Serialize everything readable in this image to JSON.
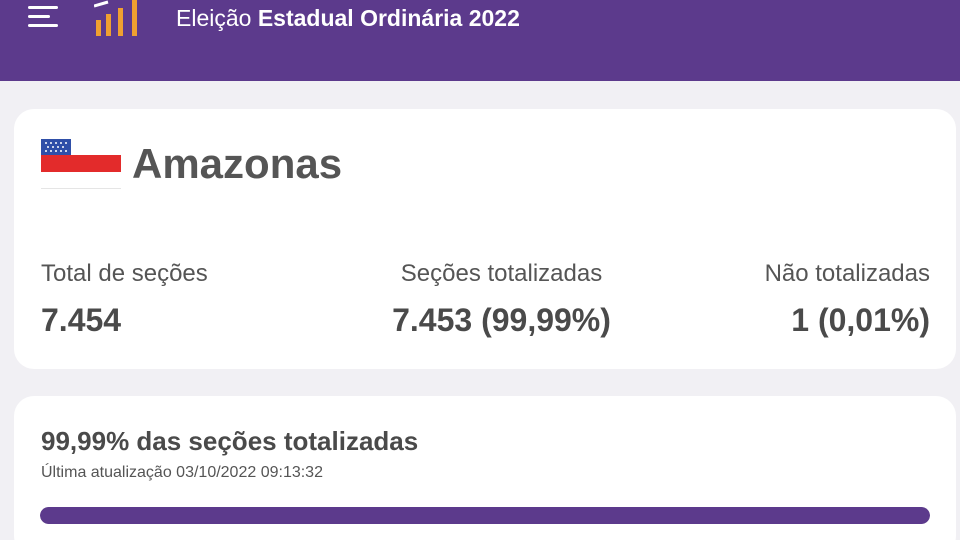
{
  "header": {
    "title_prefix": "Eleição",
    "title_main": "Estadual Ordinária 2022",
    "bar_color": "#5c3a8c",
    "menu_icon": "hamburger-menu-icon",
    "logo_icon": "bar-chart-logo-icon"
  },
  "state": {
    "name": "Amazonas",
    "flag_icon": "amazonas-flag-icon",
    "stats": [
      {
        "label": "Total de seções",
        "value": "7.454"
      },
      {
        "label": "Seções totalizadas",
        "value": "7.453 (99,99%)"
      },
      {
        "label": "Não totalizadas",
        "value": "1 (0,01%)"
      }
    ]
  },
  "progress": {
    "title": "99,99% das seções totalizadas",
    "updated": "Última atualização 03/10/2022 09:13:32",
    "percent": 99.99,
    "fill_color": "#5c3a8c"
  }
}
